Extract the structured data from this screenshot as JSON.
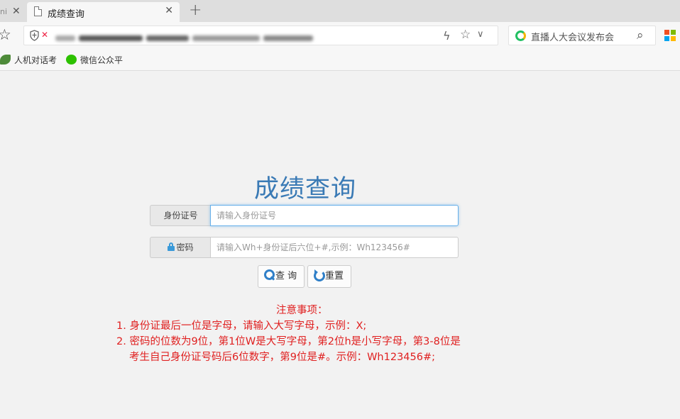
{
  "browser": {
    "prev_tab_fragment": "ni",
    "active_tab_title": "成绩查询",
    "close_symbol": "✕",
    "new_tab_symbol": "+",
    "search_suggestion": "直播人大会议发布会",
    "bookmarks": [
      "人机对话考",
      "微信公众平"
    ],
    "colors": {
      "tab_strip": "#dedede",
      "toolbar": "#f7f7f7"
    },
    "icons": [
      "star-icon",
      "shield-icon",
      "insecure-lock-icon",
      "lightning-icon",
      "bookmark-star-icon",
      "chevron-down-icon",
      "search-engine-logo-icon",
      "search-icon",
      "windows-logo-icon",
      "document-icon"
    ]
  },
  "page": {
    "title": "成绩查询",
    "id_label": "身份证号",
    "id_placeholder": "请输入身份证号",
    "password_label": "密码",
    "password_placeholder": "请输入Wh+身份证后六位+#,示例：Wh123456#",
    "query_button": "查 询",
    "reset_button": "重置",
    "notes_title": "注意事项：",
    "note_1": "1. 身份证最后一位是字母，请输入大写字母，示例：X;",
    "note_2_line1": "2. 密码的位数为9位，第1位W是大写字母，第2位h是小写字母，第3-8位是",
    "note_2_line2": "考生自己身份证号码后6位数字，第9位是#。示例：Wh123456#;",
    "colors": {
      "title": "#3a7ab5",
      "notes": "#e02020",
      "background": "#f2f2f2",
      "icon_blue": "#2f7fc8"
    }
  }
}
